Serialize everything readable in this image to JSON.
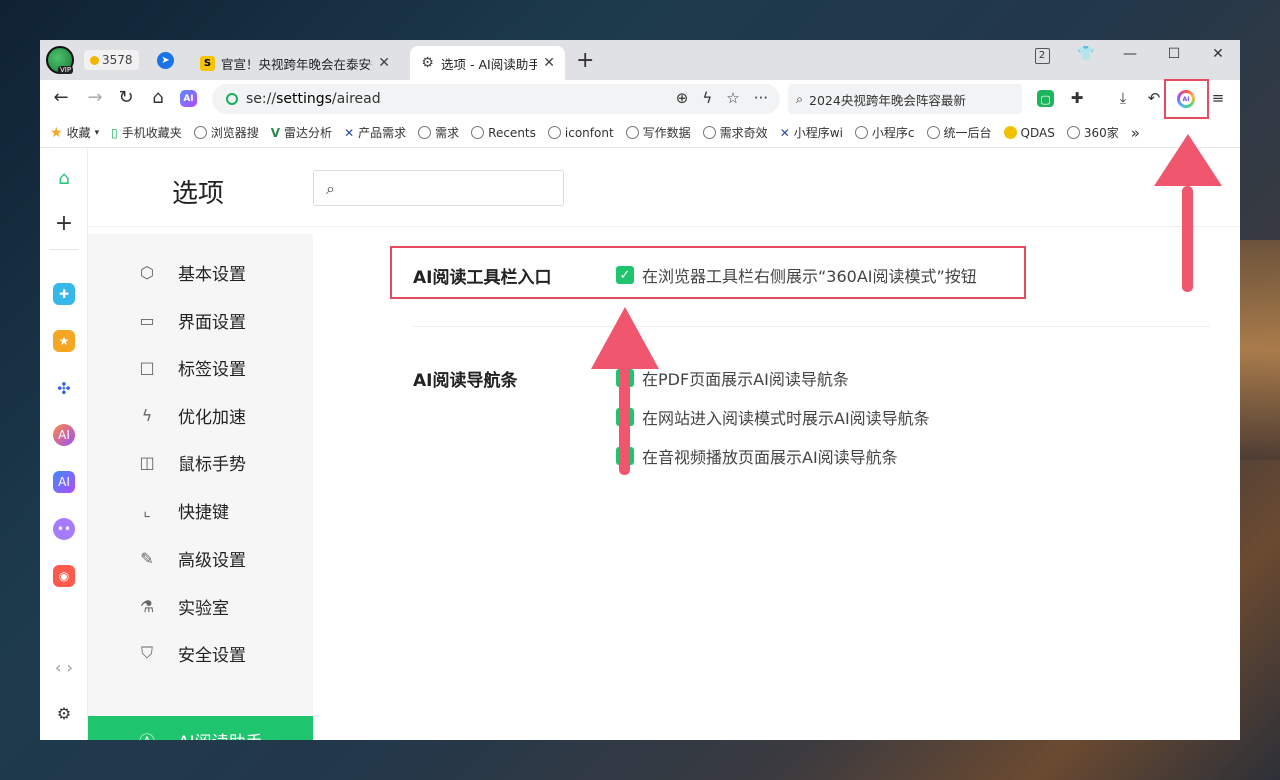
{
  "browser": {
    "coins": "3578",
    "tabs": [
      {
        "title": "官宣！央视跨年晚会在泰安举办",
        "active": false
      },
      {
        "title": "选项 - AI阅读助手",
        "active": true
      }
    ],
    "address": {
      "scheme": "se://",
      "host": "settings",
      "path": "/airead"
    },
    "search_box": "2024央视跨年晚会阵容最新",
    "tab_count": "2"
  },
  "bookmarks": [
    {
      "label": "收藏",
      "icon": "star-icon"
    },
    {
      "label": "手机收藏夹",
      "icon": "phone-icon"
    },
    {
      "label": "浏览器搜",
      "icon": "globe-icon"
    },
    {
      "label": "雷达分析",
      "icon": "vue-icon"
    },
    {
      "label": "产品需求",
      "icon": "tool-icon"
    },
    {
      "label": "需求",
      "icon": "globe-icon"
    },
    {
      "label": "Recents",
      "icon": "globe-icon"
    },
    {
      "label": "iconfont",
      "icon": "globe-icon"
    },
    {
      "label": "写作数据",
      "icon": "globe-icon"
    },
    {
      "label": "需求奇效",
      "icon": "globe-icon"
    },
    {
      "label": "小程序wi",
      "icon": "tool-icon"
    },
    {
      "label": "小程序c",
      "icon": "globe-icon"
    },
    {
      "label": "统一后台",
      "icon": "globe-icon"
    },
    {
      "label": "QDAS",
      "icon": "qdas-icon"
    },
    {
      "label": "360家",
      "icon": "globe-icon"
    }
  ],
  "settings": {
    "title": "选项",
    "search_placeholder": "",
    "nav": [
      {
        "label": "基本设置",
        "icon": "gear-outline-icon",
        "active": false
      },
      {
        "label": "界面设置",
        "icon": "window-icon",
        "active": false
      },
      {
        "label": "标签设置",
        "icon": "tab-icon",
        "active": false
      },
      {
        "label": "优化加速",
        "icon": "bolt-icon",
        "active": false
      },
      {
        "label": "鼠标手势",
        "icon": "mouse-icon",
        "active": false
      },
      {
        "label": "快捷键",
        "icon": "shortcut-icon",
        "active": false
      },
      {
        "label": "高级设置",
        "icon": "wrench-icon",
        "active": false
      },
      {
        "label": "实验室",
        "icon": "flask-icon",
        "active": false
      },
      {
        "label": "安全设置",
        "icon": "shield-icon",
        "active": false
      },
      {
        "label": "AI阅读助手",
        "icon": "ai-icon",
        "active": true
      }
    ],
    "sections": {
      "toolbar": {
        "label": "AI阅读工具栏入口",
        "option": "在浏览器工具栏右侧展示“360AI阅读模式”按钮",
        "checked": true
      },
      "navbar": {
        "label": "AI阅读导航条",
        "options": [
          {
            "label": "在PDF页面展示AI阅读导航条",
            "checked": true
          },
          {
            "label": "在网站进入阅读模式时展示AI阅读导航条",
            "checked": true
          },
          {
            "label": "在音视频播放页面展示AI阅读导航条",
            "checked": true
          }
        ]
      }
    }
  },
  "colors": {
    "accent": "#1fc46e",
    "highlight": "#e84a5f",
    "arrow": "#f0566e"
  }
}
